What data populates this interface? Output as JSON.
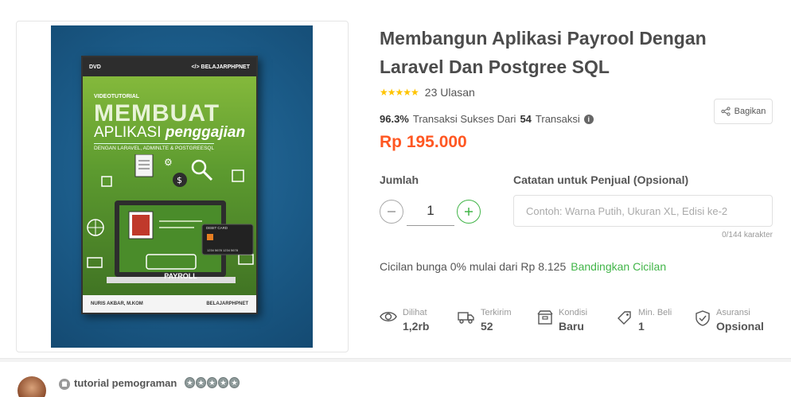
{
  "product": {
    "title": "Membangun Aplikasi Payrool Dengan Laravel Dan Postgree SQL",
    "stars": "★★★★★",
    "review_count": "23 Ulasan",
    "success_rate": "96.3%",
    "success_text": "Transaksi Sukses Dari",
    "transaction_count": "54",
    "transaction_label": "Transaksi",
    "price": "Rp 195.000",
    "share_label": "Bagikan"
  },
  "cover": {
    "dvd_label": "DVD",
    "brand": "</> BELAJARPHPNET",
    "videotutorial": "VIDEOTUTORIAL",
    "title_line1": "MEMBUAT",
    "title_line2a": "APLIKASI",
    "title_line2b": "penggajian",
    "subtitle": "DENGAN LARAVEL, ADMINLTE & POSTGREESQL",
    "payroll": "PAYROLL",
    "debit_card": "DEBIT CARD",
    "card_number": "1234 5678 1234 5678",
    "author": "NURIS AKBAR, M.KOM",
    "footer_brand": "BELAJARPHPNET"
  },
  "order": {
    "qty_label": "Jumlah",
    "qty_value": "1",
    "note_label": "Catatan untuk Penjual (Opsional)",
    "note_placeholder": "Contoh: Warna Putih, Ukuran XL, Edisi ke-2",
    "note_counter": "0/144 karakter"
  },
  "installment": {
    "text": "Cicilan bunga 0% mulai dari Rp 8.125",
    "link": "Bandingkan Cicilan"
  },
  "meta": [
    {
      "label": "Dilihat",
      "value": "1,2rb",
      "icon": "eye-icon"
    },
    {
      "label": "Terkirim",
      "value": "52",
      "icon": "truck-icon"
    },
    {
      "label": "Kondisi",
      "value": "Baru",
      "icon": "box-icon"
    },
    {
      "label": "Min. Beli",
      "value": "1",
      "icon": "tag-icon"
    },
    {
      "label": "Asuransi",
      "value": "Opsional",
      "icon": "shield-check-icon"
    }
  ],
  "shop": {
    "name": "tutorial pemograman",
    "badge_count": 5
  },
  "colors": {
    "price": "#ff5722",
    "accent_green": "#42b549",
    "star": "#ffc400"
  }
}
